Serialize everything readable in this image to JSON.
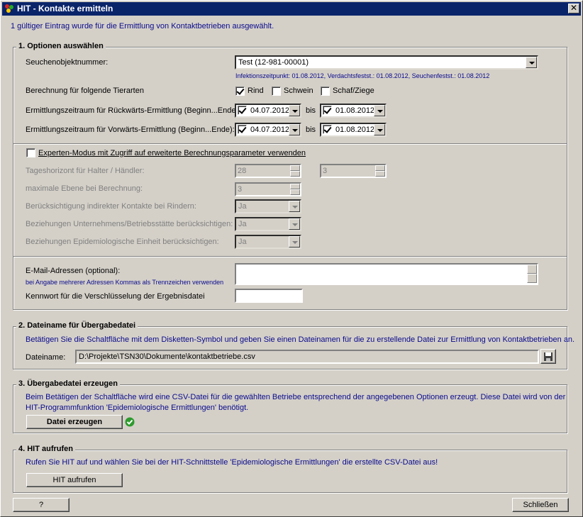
{
  "window": {
    "title": "HIT - Kontakte ermitteln",
    "close_label": "✕"
  },
  "info_text": "1 gültiger Eintrag wurde für die Ermittlung von Kontaktbetrieben ausgewählt.",
  "section1": {
    "title": "1. Optionen auswählen",
    "seuchen_label": "Seuchenobjektnummer:",
    "seuchen_value": "Test (12-981-00001)",
    "seuchen_info": "Infektionszeitpunkt: 01.08.2012, Verdachtsfestst.: 01.08.2012, Seuchenfestst.: 01.08.2012",
    "tierarten_label": "Berechnung für folgende Tierarten",
    "tierarten": [
      {
        "label": "Rind",
        "checked": true
      },
      {
        "label": "Schwein",
        "checked": false
      },
      {
        "label": "Schaf/Ziege",
        "checked": false
      }
    ],
    "rueck_label": "Ermittlungszeitraum für Rückwärts-Ermittlung (Beginn...Ende):",
    "rueck_from": "04.07.2012",
    "rueck_to": "01.08.2012",
    "vor_label": "Ermittlungszeitraum für Vorwärts-Ermittlung (Beginn...Ende):",
    "vor_from": "04.07.2012",
    "vor_to": "01.08.2012",
    "bis_label": "bis",
    "experten_label": "Experten-Modus mit Zugriff auf erweiterte Berechnungsparameter verwenden",
    "tageshorizont_label": "Tageshorizont für Halter / Händler:",
    "tageshorizont_halter": "28",
    "tageshorizont_haendler": "3",
    "ebene_label": "maximale Ebene bei Berechnung:",
    "ebene_value": "3",
    "indirekt_label": "Berücksichtigung indirekter Kontakte bei Rindern:",
    "indirekt_value": "Ja",
    "unternehmen_label": "Beziehungen Unternehmens/Betriebsstätte berücksichtigen:",
    "unternehmen_value": "Ja",
    "epi_label": "Beziehungen Epidemiologische Einheit berücksichtigen:",
    "epi_value": "Ja",
    "email_label": "E-Mail-Adressen (optional):",
    "email_hint": "bei Angabe mehrerer Adressen Kommas als Trennzeichen verwenden",
    "email_value": "",
    "kennwort_label": "Kennwort für die Verschlüsselung der Ergebnisdatei",
    "kennwort_value": ""
  },
  "section2": {
    "title": "2. Dateiname für Übergabedatei",
    "description": "Betätigen Sie die Schaltfläche mit dem Disketten-Symbol und geben Sie einen Dateinamen für die zu erstellende Datei zur Ermittlung von Kontaktbetrieben an.",
    "dateiname_label": "Dateiname:",
    "dateiname_value": "D:\\Projekte\\TSN30\\Dokumente\\kontaktbetriebe.csv"
  },
  "section3": {
    "title": "3. Übergabedatei erzeugen",
    "description_line1": "Beim Betätigen der Schaltfläche wird eine CSV-Datei für die gewählten Betriebe entsprechend der angegebenen Optionen erzeugt. Diese Datei wird von der",
    "description_line2": "HIT-Programmfunktion 'Epidemiologische Ermittlungen' benötigt.",
    "button_label": "Datei erzeugen"
  },
  "section4": {
    "title": "4. HIT aufrufen",
    "description": "Rufen Sie HIT auf und wählen Sie bei der HIT-Schnittstelle 'Epidemiologische Ermittlungen' die erstellte CSV-Datei aus!",
    "button_label": "HIT aufrufen"
  },
  "footer": {
    "help_label": "?",
    "close_label": "Schließen"
  },
  "colors": {
    "titlebar": "#0a246a",
    "info_text": "#0a0a8c",
    "face": "#d4d0c8",
    "success": "#2e9a2e"
  }
}
